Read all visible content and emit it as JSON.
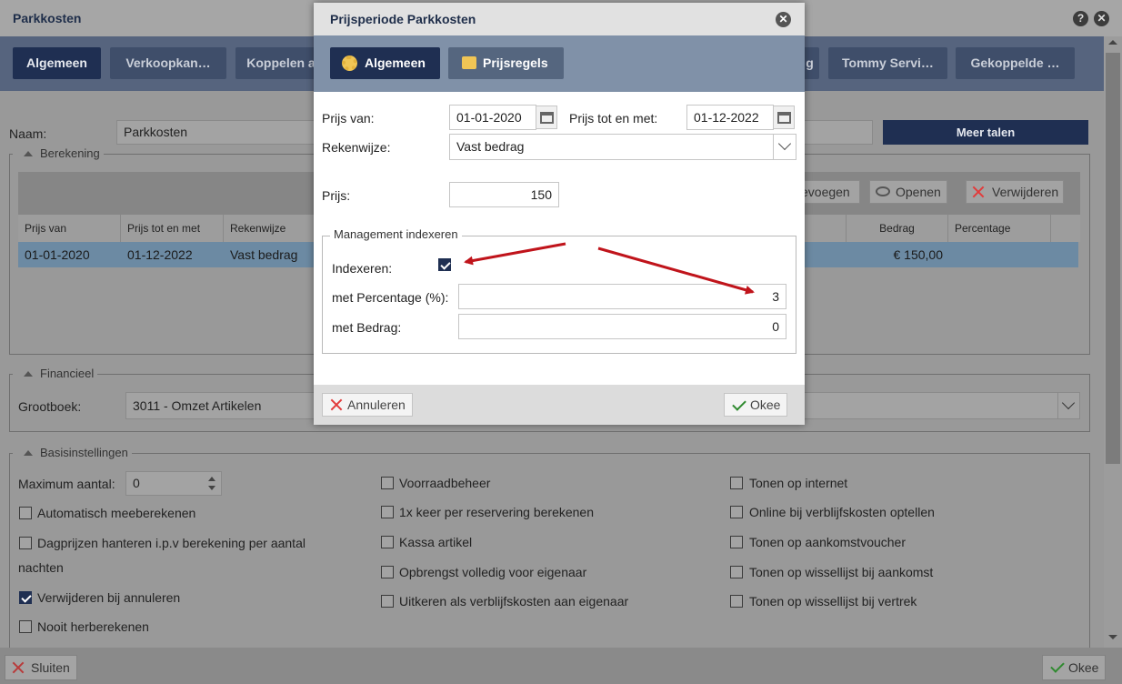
{
  "window": {
    "title": "Parkkosten",
    "tabs": [
      {
        "label": "Algemeen"
      },
      {
        "label": "Verkoopkan…"
      },
      {
        "label": "Koppelen a"
      },
      {
        "label": "g"
      },
      {
        "label": "Tommy Servi…"
      },
      {
        "label": "Gekoppelde …"
      }
    ]
  },
  "form": {
    "naam_label": "Naam:",
    "naam_value": "Parkkosten",
    "meer_talen": "Meer talen"
  },
  "berekening": {
    "legend": "Berekening",
    "toolbar": {
      "toevoegen": "evoegen",
      "openen": "Openen",
      "verwijderen": "Verwijderen"
    },
    "columns": [
      "Prijs van",
      "Prijs tot en met",
      "Rekenwijze",
      "Bedrag",
      "Percentage"
    ],
    "rows": [
      {
        "prijs_van": "01-01-2020",
        "prijs_tot": "01-12-2022",
        "rekenwijze": "Vast bedrag",
        "bedrag": "€ 150,00",
        "percentage": ""
      }
    ]
  },
  "financieel": {
    "legend": "Financieel",
    "grootboek_label": "Grootboek:",
    "grootboek_value": "3011 - Omzet Artikelen"
  },
  "basis": {
    "legend": "Basisinstellingen",
    "max_label": "Maximum aantal:",
    "max_value": "0",
    "col1": [
      {
        "label": "Automatisch meeberekenen",
        "checked": false
      },
      {
        "label": "Dagprijzen hanteren i.p.v berekening per aantal",
        "checked": false
      },
      {
        "label": "nachten",
        "checked": false
      },
      {
        "label": "Verwijderen bij annuleren",
        "checked": true
      },
      {
        "label": "Nooit herberekenen",
        "checked": false
      }
    ],
    "col2": [
      {
        "label": "Voorraadbeheer",
        "checked": false
      },
      {
        "label": "1x keer per reservering berekenen",
        "checked": false
      },
      {
        "label": "Kassa artikel",
        "checked": false
      },
      {
        "label": "Opbrengst volledig voor eigenaar",
        "checked": false
      },
      {
        "label": "Uitkeren als verblijfskosten aan eigenaar",
        "checked": false
      }
    ],
    "col3": [
      {
        "label": "Tonen op internet",
        "checked": false
      },
      {
        "label": "Online bij verblijfskosten optellen",
        "checked": false
      },
      {
        "label": "Tonen op aankomstvoucher",
        "checked": false
      },
      {
        "label": "Tonen op wissellijst bij aankomst",
        "checked": false
      },
      {
        "label": "Tonen op wissellijst bij vertrek",
        "checked": false
      }
    ]
  },
  "footer": {
    "sluiten": "Sluiten",
    "okee": "Okee"
  },
  "dialog": {
    "title": "Prijsperiode Parkkosten",
    "tabs": [
      {
        "label": "Algemeen"
      },
      {
        "label": "Prijsregels"
      }
    ],
    "prijs_van_label": "Prijs van:",
    "prijs_van_value": "01-01-2020",
    "prijs_tot_label": "Prijs tot en met:",
    "prijs_tot_value": "01-12-2022",
    "rekenwijze_label": "Rekenwijze:",
    "rekenwijze_value": "Vast bedrag",
    "prijs_label": "Prijs:",
    "prijs_value": "150",
    "mgmt_legend": "Management indexeren",
    "indexeren_label": "Indexeren:",
    "indexeren_checked": true,
    "percentage_label": "met Percentage (%):",
    "percentage_value": "3",
    "bedrag_label": "met Bedrag:",
    "bedrag_value": "0",
    "annuleren": "Annuleren",
    "okee": "Okee"
  },
  "colors": {
    "arrow": "#c0141b",
    "accent": "#1f2f52",
    "selected_row": "#6c8aa3"
  }
}
